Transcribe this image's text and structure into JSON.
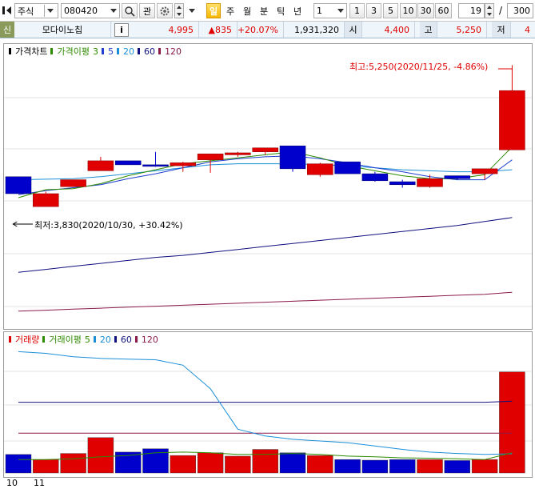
{
  "toolbar": {
    "market": "주식",
    "code": "080420",
    "watch_label": "관",
    "periods": [
      "일",
      "주",
      "월",
      "분",
      "틱",
      "년"
    ],
    "selected_period": "일",
    "interval_value": "1",
    "quick_intervals": [
      "1",
      "3",
      "5",
      "10",
      "30",
      "60"
    ],
    "count_value": "19",
    "count_separator": "/",
    "total_count": "300"
  },
  "info": {
    "credit_badge": "신",
    "name": "모다이노칩",
    "info_button": "i",
    "price": "4,995",
    "change": "▲835",
    "change_pct": "+20.07%",
    "volume": "1,931,320",
    "open_label": "시",
    "open": "4,400",
    "high_label": "고",
    "high": "5,250",
    "low_label": "저",
    "low": "4"
  },
  "price_pane": {
    "legend": {
      "title": "가격차트",
      "ma_title": "가격이평",
      "ma": [
        "3",
        "5",
        "20",
        "60",
        "120"
      ]
    },
    "max_annotation": "최고:5,250(2020/11/25, -4.86%)",
    "min_annotation": "최저:3,830(2020/10/30, +30.42%)"
  },
  "volume_pane": {
    "legend": {
      "title": "거래량",
      "ma_title": "거래이평",
      "ma": [
        "5",
        "20",
        "60",
        "120"
      ]
    }
  },
  "x_axis": {
    "labels": [
      "10",
      "11"
    ]
  },
  "colors": {
    "up": "#e00000",
    "down": "#0000cc",
    "ma3": "#2e8b00",
    "ma5": "#1f3fd0",
    "ma20": "#1a8fd8",
    "ma60": "#101080",
    "ma120": "#8b1a4a"
  },
  "chart_data": {
    "type": "candlestick",
    "candles": [
      {
        "open": 4130,
        "high": 4130,
        "low": 3960,
        "close": 3960
      },
      {
        "open": 3830,
        "high": 3980,
        "low": 3830,
        "close": 3960
      },
      {
        "open": 4030,
        "high": 4100,
        "low": 4030,
        "close": 4100
      },
      {
        "open": 4190,
        "high": 4330,
        "low": 4190,
        "close": 4290
      },
      {
        "open": 4290,
        "high": 4290,
        "low": 4250,
        "close": 4250
      },
      {
        "open": 4250,
        "high": 4380,
        "low": 4230,
        "close": 4240
      },
      {
        "open": 4240,
        "high": 4280,
        "low": 4180,
        "close": 4270
      },
      {
        "open": 4300,
        "high": 4360,
        "low": 4170,
        "close": 4360
      },
      {
        "open": 4350,
        "high": 4380,
        "low": 4330,
        "close": 4370
      },
      {
        "open": 4380,
        "high": 4420,
        "low": 4350,
        "close": 4420
      },
      {
        "open": 4440,
        "high": 4440,
        "low": 4180,
        "close": 4210
      },
      {
        "open": 4150,
        "high": 4270,
        "low": 4130,
        "close": 4260
      },
      {
        "open": 4280,
        "high": 4280,
        "low": 4160,
        "close": 4160
      },
      {
        "open": 4160,
        "high": 4180,
        "low": 4080,
        "close": 4090
      },
      {
        "open": 4080,
        "high": 4100,
        "low": 4020,
        "close": 4050
      },
      {
        "open": 4030,
        "high": 4150,
        "low": 4020,
        "close": 4110
      },
      {
        "open": 4140,
        "high": 4140,
        "low": 4100,
        "close": 4110
      },
      {
        "open": 4160,
        "high": 4210,
        "low": 4100,
        "close": 4210
      },
      {
        "open": 4400,
        "high": 5250,
        "low": 4400,
        "close": 4995
      }
    ],
    "ma3": [
      3920,
      4000,
      4010,
      4060,
      4140,
      4200,
      4260,
      4290,
      4320,
      4350,
      4380,
      4320,
      4240,
      4190,
      4140,
      4110,
      4110,
      4150,
      4430
    ],
    "ma5": [
      3950,
      3990,
      4020,
      4050,
      4110,
      4160,
      4220,
      4280,
      4310,
      4330,
      4340,
      4310,
      4270,
      4220,
      4180,
      4130,
      4100,
      4100,
      4300
    ],
    "ma20": [
      4100,
      4105,
      4110,
      4130,
      4160,
      4190,
      4220,
      4250,
      4260,
      4260,
      4260,
      4250,
      4240,
      4220,
      4200,
      4190,
      4180,
      4180,
      4200
    ],
    "ma60": [
      3170,
      3200,
      3230,
      3260,
      3290,
      3320,
      3340,
      3370,
      3400,
      3430,
      3460,
      3490,
      3520,
      3550,
      3580,
      3610,
      3640,
      3680,
      3720
    ],
    "ma120": [
      2780,
      2790,
      2800,
      2810,
      2820,
      2830,
      2840,
      2850,
      2860,
      2870,
      2880,
      2890,
      2900,
      2910,
      2920,
      2930,
      2940,
      2950,
      2970
    ],
    "price_range": [
      2650,
      5350
    ],
    "volumes": [
      55,
      40,
      58,
      105,
      62,
      72,
      52,
      60,
      50,
      70,
      60,
      52,
      40,
      38,
      40,
      40,
      37,
      40,
      300
    ],
    "vol_ma5": [
      40,
      40,
      42,
      48,
      52,
      60,
      62,
      60,
      55,
      55,
      58,
      55,
      50,
      48,
      45,
      44,
      42,
      40,
      60
    ],
    "vol_ma20": [
      360,
      355,
      345,
      340,
      338,
      336,
      320,
      250,
      130,
      110,
      100,
      95,
      90,
      80,
      70,
      62,
      58,
      55,
      57
    ],
    "vol_ma60": [
      210,
      210,
      210,
      210,
      210,
      210,
      210,
      210,
      210,
      210,
      210,
      210,
      210,
      210,
      210,
      210,
      210,
      210,
      213
    ],
    "vol_ma120": [
      118,
      118,
      118,
      118,
      118,
      118,
      118,
      118,
      118,
      118,
      118,
      118,
      118,
      118,
      118,
      118,
      118,
      118,
      118
    ],
    "volume_range": [
      0,
      380
    ]
  }
}
